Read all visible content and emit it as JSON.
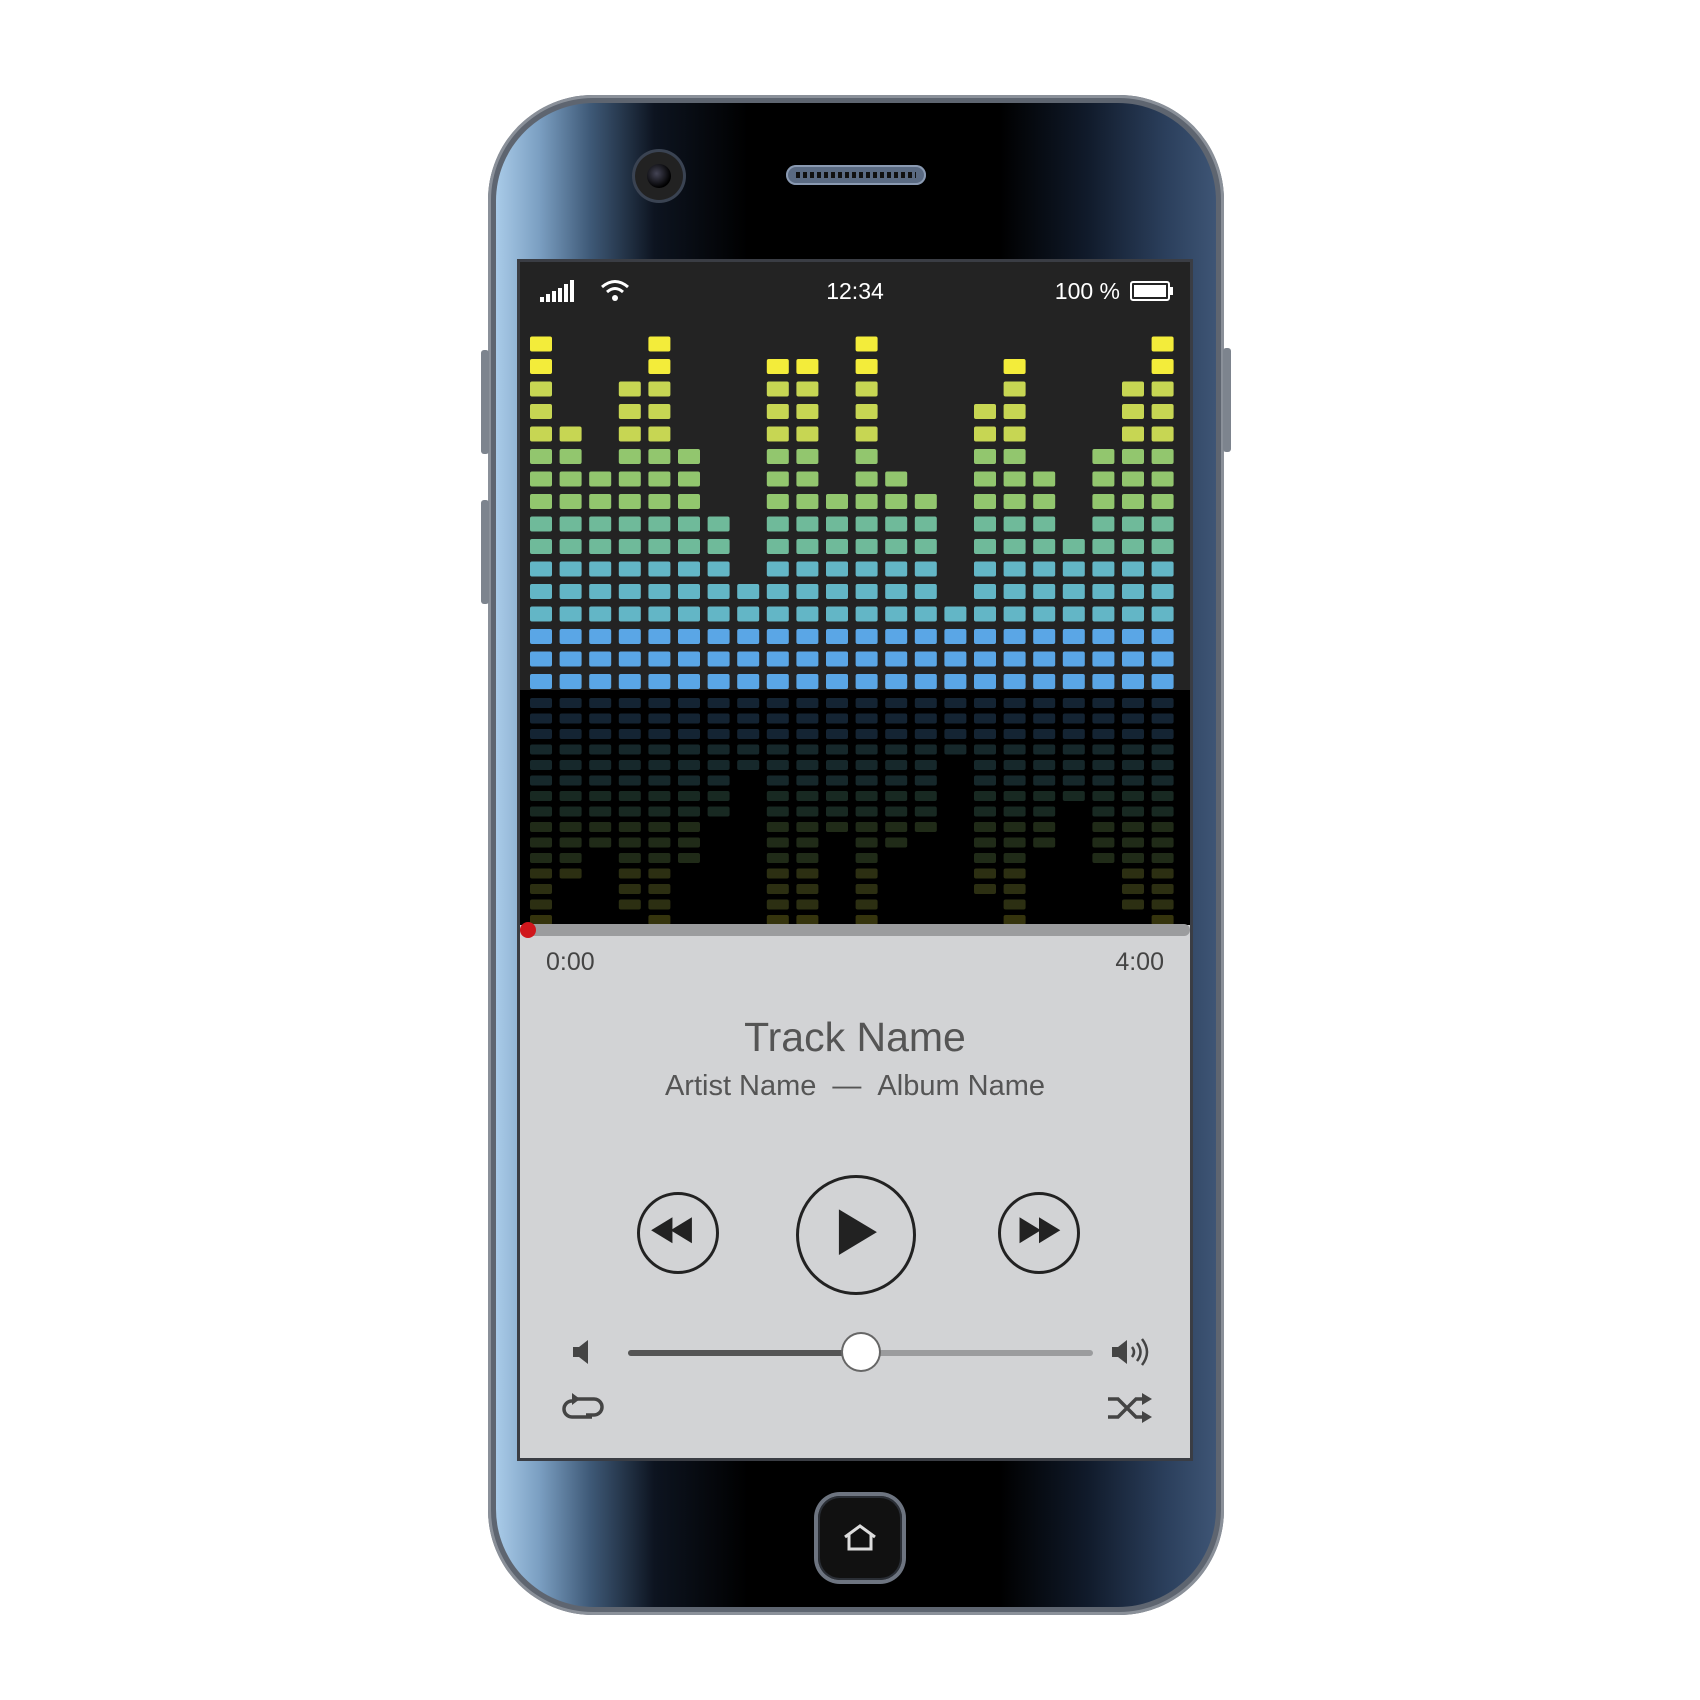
{
  "status_bar": {
    "time": "12:34",
    "battery": "100 %",
    "icons": [
      "signal-icon",
      "wifi-icon",
      "battery-icon"
    ]
  },
  "equalizer": {
    "bar_levels": [
      16,
      12,
      10,
      14,
      16,
      11,
      8,
      5,
      15,
      15,
      9,
      16,
      10,
      9,
      4,
      13,
      15,
      10,
      7,
      11,
      14,
      16
    ],
    "colors": [
      "#5aa6e6",
      "#63b6c6",
      "#6fba9a",
      "#92c66e",
      "#c7d653",
      "#f3ec3a"
    ]
  },
  "player": {
    "progress": 0.0,
    "time_elapsed": "0:00",
    "time_total": "4:00",
    "track_name": "Track Name",
    "artist_name": "Artist Name",
    "separator": "—",
    "album_name": "Album Name",
    "volume": 0.5,
    "accent_color": "#d0161c",
    "controls": [
      "rewind-icon",
      "play-icon",
      "fast-forward-icon",
      "volume-low-icon",
      "volume-high-icon",
      "repeat-icon",
      "shuffle-icon"
    ]
  }
}
